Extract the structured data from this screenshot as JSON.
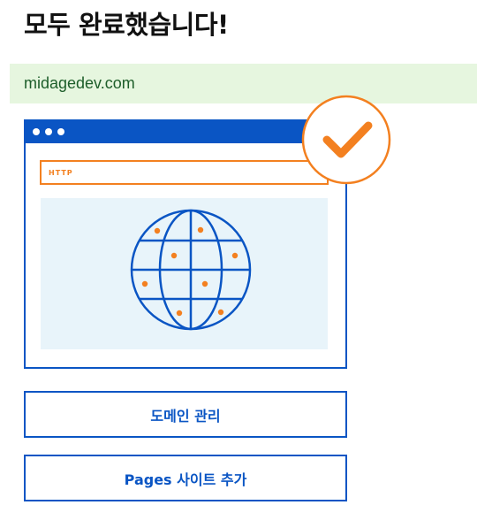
{
  "page": {
    "title": "모두 완료했습니다!"
  },
  "domain": {
    "name": "midagedev.com"
  },
  "illustration": {
    "url_bar_label": "HTTP"
  },
  "actions": {
    "manage_domain": "도메인 관리",
    "add_pages_site": "Pages 사이트 추가"
  },
  "colors": {
    "primary": "#0a55c4",
    "accent": "#f38020",
    "success_bg": "#e6f6df",
    "domain_text": "#1d5e2a"
  }
}
